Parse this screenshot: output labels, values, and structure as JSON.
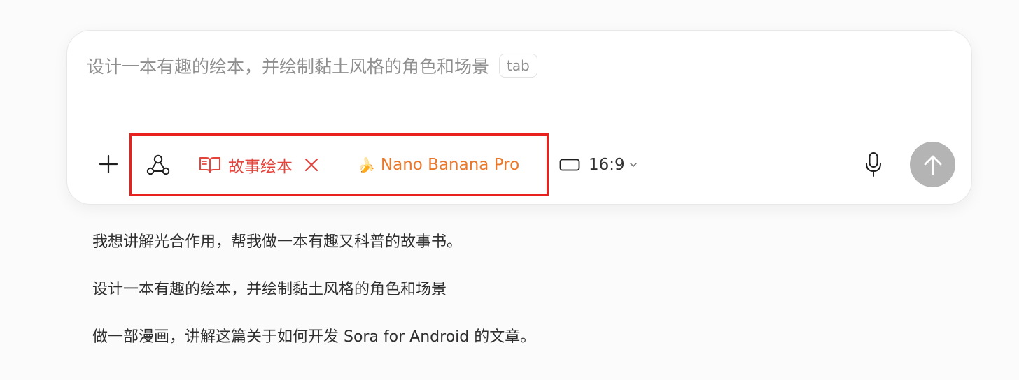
{
  "composer": {
    "placeholder": "设计一本有趣的绘本，并绘制黏土风格的角色和场景",
    "tab_hint": "tab"
  },
  "toolbar": {
    "add_icon": "plus-icon",
    "workflow_icon": "workflow-icon",
    "skill": {
      "icon": "book-icon",
      "label": "故事绘本",
      "remove_icon": "close-icon"
    },
    "model": {
      "icon": "banana-icon",
      "emoji": "🍌",
      "label": "Nano Banana Pro"
    },
    "aspect_ratio": {
      "icon": "aspect-ratio-icon",
      "label": "16:9",
      "dropdown_icon": "chevron-down-icon"
    },
    "mic_icon": "microphone-icon",
    "send_icon": "arrow-up-icon"
  },
  "suggestions": [
    "我想讲解光合作用，帮我做一本有趣又科普的故事书。",
    "设计一本有趣的绘本，并绘制黏土风格的角色和场景",
    "做一部漫画，讲解这篇关于如何开发 Sora for Android 的文章。"
  ],
  "colors": {
    "skill": "#e3453d",
    "model": "#e8782c",
    "highlight": "#e8211f",
    "send_disabled": "#b4b4b4"
  }
}
